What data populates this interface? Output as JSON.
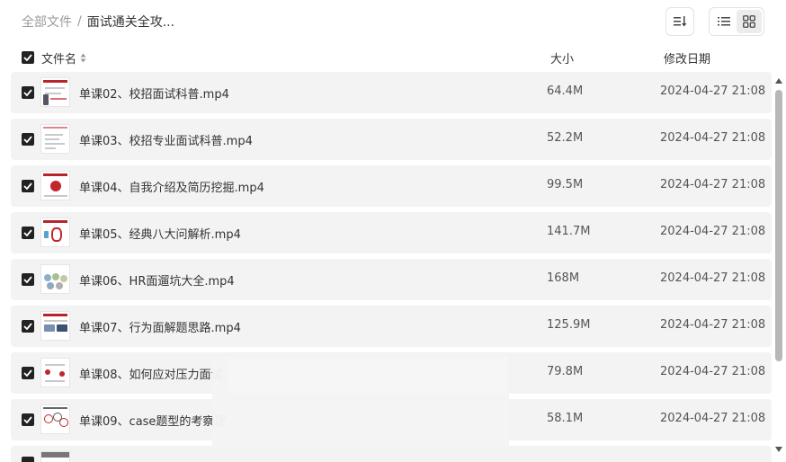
{
  "breadcrumb": {
    "root": "全部文件",
    "separator": "/",
    "current": "面试通关全攻..."
  },
  "header": {
    "name": "文件名",
    "size": "大小",
    "date": "修改日期"
  },
  "files": [
    {
      "name": "单课02、校招面试科普.mp4",
      "size": "64.4M",
      "date": "2024-04-27 21:08"
    },
    {
      "name": "单课03、校招专业面试科普.mp4",
      "size": "52.2M",
      "date": "2024-04-27 21:08"
    },
    {
      "name": "单课04、自我介绍及简历挖掘.mp4",
      "size": "99.5M",
      "date": "2024-04-27 21:08"
    },
    {
      "name": "单课05、经典八大问解析.mp4",
      "size": "141.7M",
      "date": "2024-04-27 21:08"
    },
    {
      "name": "单课06、HR面遛坑大全.mp4",
      "size": "168M",
      "date": "2024-04-27 21:08"
    },
    {
      "name": "单课07、行为面解题思路.mp4",
      "size": "125.9M",
      "date": "2024-04-27 21:08"
    },
    {
      "name": "单课08、如何应对压力面试.",
      "size": "79.8M",
      "date": "2024-04-27 21:08"
    },
    {
      "name": "单课09、case题型的考察逻",
      "size": "58.1M",
      "date": "2024-04-27 21:08"
    }
  ],
  "colors": {
    "accent_red": "#b8242a",
    "row_bg": "#f3f3f3",
    "checkbox": "#222222"
  },
  "icons": [
    "sort-icon",
    "list-view-icon",
    "grid-view-icon",
    "checkbox-checked-icon",
    "scroll-up-icon",
    "scroll-down-icon"
  ]
}
